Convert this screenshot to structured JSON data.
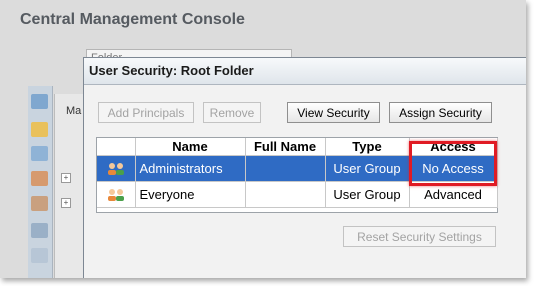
{
  "app": {
    "title": "Central Management Console",
    "folder_combo_text": "Folder"
  },
  "background": {
    "tab_label": "Ma"
  },
  "dialog": {
    "title": "User Security: Root Folder",
    "buttons": {
      "add_principals": "Add Principals",
      "remove": "Remove",
      "view_security": "View Security",
      "assign_security": "Assign Security",
      "reset_security": "Reset Security Settings"
    },
    "table": {
      "headers": [
        "",
        "Name",
        "Full Name",
        "Type",
        "Access"
      ],
      "rows": [
        {
          "icon": "user-group-icon",
          "name": "Administrators",
          "full_name": "",
          "type": "User Group",
          "access": "No Access",
          "selected": true
        },
        {
          "icon": "user-group-icon",
          "name": "Everyone",
          "full_name": "",
          "type": "User Group",
          "access": "Advanced",
          "selected": false
        }
      ]
    }
  },
  "colors": {
    "selection": "#2f6bc4",
    "highlight": "#e01b24"
  }
}
